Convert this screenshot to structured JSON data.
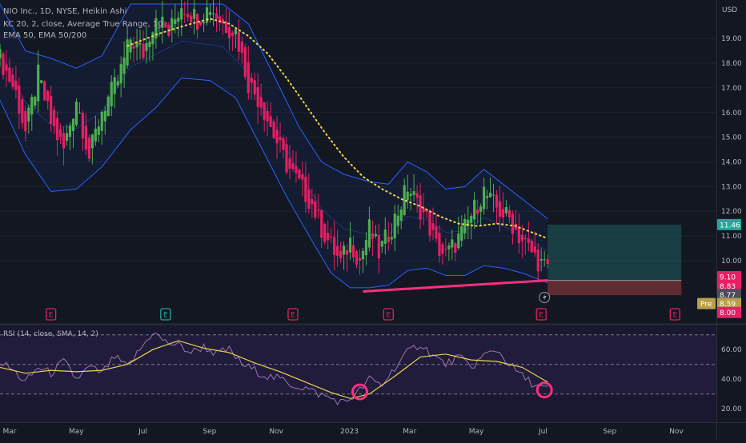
{
  "legend": {
    "line1": "NIO Inc., 1D, NYSE, Heikin Ashi",
    "line2": "KC 20, 2, close, Average True Range, 10",
    "line3": "EMA 50, EMA 50/200"
  },
  "price_axis": {
    "unit": "USD",
    "ticks": [
      "19.00",
      "18.00",
      "17.00",
      "16.00",
      "15.00",
      "14.00",
      "13.00",
      "12.00",
      "11.00",
      "10.00"
    ]
  },
  "price_badges": {
    "target": "11.46",
    "current": "9.10",
    "b2": "8.83",
    "b3": "8.77",
    "pre_label": "Pre",
    "pre_value": "8.59",
    "stop": "8.00"
  },
  "earnings_label": "E",
  "rsi": {
    "title": "RSI (14, close, SMA, 14, 2)",
    "ticks": [
      "60.00",
      "40.00",
      "20.00"
    ]
  },
  "time_axis": [
    "Mar",
    "May",
    "Jul",
    "Sep",
    "Nov",
    "2023",
    "Mar",
    "May",
    "Jul",
    "Sep",
    "Nov"
  ],
  "colors": {
    "background": "#131722",
    "candle_up": "#4caf50",
    "candle_down": "#e91e63",
    "channel": "#2962ff",
    "ema": "#e8d44d",
    "rsi_line": "#b085c8",
    "rsi_ma": "#e8d44d",
    "target_zone": "#26a69a",
    "stop_zone": "#ef5350",
    "annotation": "#ff2e7e"
  },
  "chart_data": {
    "type": "candlestick",
    "symbol": "NIO",
    "ylim": [
      7.6,
      20.4
    ],
    "x_months": [
      "Mar",
      "May",
      "Jul",
      "Sep",
      "Nov",
      "2023",
      "Mar",
      "May",
      "Jul",
      "Sep",
      "Nov"
    ],
    "price_path": [
      [
        0,
        18.2
      ],
      [
        5,
        16.8
      ],
      [
        8,
        15.2
      ],
      [
        12,
        17.5
      ],
      [
        16,
        15.6
      ],
      [
        20,
        14.5
      ],
      [
        24,
        16.6
      ],
      [
        28,
        14.2
      ],
      [
        32,
        16.1
      ],
      [
        37,
        17.3
      ],
      [
        41,
        19.0
      ],
      [
        45,
        18.4
      ],
      [
        49,
        20.0
      ],
      [
        53,
        19.2
      ],
      [
        57,
        20.4
      ],
      [
        62,
        19.8
      ],
      [
        66,
        20.3
      ],
      [
        70,
        19.6
      ],
      [
        74,
        19.3
      ],
      [
        78,
        17.2
      ],
      [
        82,
        16.4
      ],
      [
        86,
        15.1
      ],
      [
        90,
        13.9
      ],
      [
        94,
        13.1
      ],
      [
        98,
        12.3
      ],
      [
        101,
        11.3
      ],
      [
        104,
        10.6
      ],
      [
        107,
        9.9
      ],
      [
        110,
        10.8
      ],
      [
        113,
        10.0
      ],
      [
        116,
        11.3
      ],
      [
        119,
        10.3
      ],
      [
        122,
        11.1
      ],
      [
        125,
        12.0
      ],
      [
        128,
        13.0
      ],
      [
        131,
        12.3
      ],
      [
        134,
        11.7
      ],
      [
        137,
        10.6
      ],
      [
        140,
        10.2
      ],
      [
        143,
        10.7
      ],
      [
        146,
        11.3
      ],
      [
        149,
        12.1
      ],
      [
        152,
        12.8
      ],
      [
        154,
        12.4
      ],
      [
        157,
        12.0
      ],
      [
        160,
        11.7
      ],
      [
        163,
        11.0
      ],
      [
        166,
        10.5
      ],
      [
        169,
        10.0
      ],
      [
        172,
        9.6
      ]
    ],
    "keltner_upper": [
      [
        0,
        20.4
      ],
      [
        8,
        18.5
      ],
      [
        16,
        18.2
      ],
      [
        24,
        17.8
      ],
      [
        32,
        18.3
      ],
      [
        41,
        20.4
      ],
      [
        57,
        20.4
      ],
      [
        70,
        20.4
      ],
      [
        78,
        19.6
      ],
      [
        86,
        17.5
      ],
      [
        94,
        15.4
      ],
      [
        101,
        14.0
      ],
      [
        108,
        13.5
      ],
      [
        116,
        13.2
      ],
      [
        122,
        13.1
      ],
      [
        128,
        14.0
      ],
      [
        134,
        13.6
      ],
      [
        140,
        12.9
      ],
      [
        146,
        13.0
      ],
      [
        152,
        13.7
      ],
      [
        158,
        13.1
      ],
      [
        164,
        12.5
      ],
      [
        172,
        11.7
      ]
    ],
    "keltner_lower": [
      [
        0,
        16.5
      ],
      [
        8,
        14.3
      ],
      [
        16,
        12.8
      ],
      [
        24,
        12.9
      ],
      [
        32,
        13.8
      ],
      [
        41,
        15.3
      ],
      [
        49,
        16.2
      ],
      [
        57,
        17.4
      ],
      [
        66,
        17.3
      ],
      [
        74,
        16.6
      ],
      [
        82,
        14.6
      ],
      [
        90,
        12.6
      ],
      [
        98,
        10.8
      ],
      [
        104,
        9.5
      ],
      [
        110,
        8.9
      ],
      [
        116,
        8.9
      ],
      [
        122,
        9.0
      ],
      [
        128,
        9.6
      ],
      [
        134,
        9.7
      ],
      [
        140,
        9.4
      ],
      [
        146,
        9.4
      ],
      [
        152,
        9.8
      ],
      [
        158,
        9.7
      ],
      [
        164,
        9.5
      ],
      [
        172,
        9.1
      ]
    ],
    "ema": [
      [
        40,
        18.7
      ],
      [
        50,
        19.2
      ],
      [
        60,
        19.6
      ],
      [
        66,
        19.8
      ],
      [
        72,
        19.6
      ],
      [
        78,
        19.1
      ],
      [
        84,
        18.4
      ],
      [
        90,
        17.4
      ],
      [
        96,
        16.3
      ],
      [
        102,
        15.2
      ],
      [
        108,
        14.2
      ],
      [
        114,
        13.4
      ],
      [
        120,
        12.9
      ],
      [
        126,
        12.5
      ],
      [
        132,
        12.2
      ],
      [
        138,
        11.8
      ],
      [
        144,
        11.5
      ],
      [
        150,
        11.4
      ],
      [
        156,
        11.5
      ],
      [
        162,
        11.4
      ],
      [
        168,
        11.1
      ],
      [
        172,
        10.9
      ]
    ],
    "support_line": [
      [
        114,
        8.75
      ],
      [
        172,
        9.2
      ]
    ],
    "long_position": {
      "entry": 9.2,
      "target": 11.46,
      "stop": 8.6,
      "start_day": 172,
      "end_day": 214
    },
    "rsi_values": [
      [
        0,
        52
      ],
      [
        4,
        46
      ],
      [
        8,
        38
      ],
      [
        12,
        48
      ],
      [
        16,
        44
      ],
      [
        20,
        52
      ],
      [
        24,
        40
      ],
      [
        28,
        48
      ],
      [
        32,
        44
      ],
      [
        36,
        55
      ],
      [
        40,
        48
      ],
      [
        44,
        60
      ],
      [
        48,
        72
      ],
      [
        52,
        65
      ],
      [
        56,
        63
      ],
      [
        60,
        58
      ],
      [
        64,
        62
      ],
      [
        68,
        57
      ],
      [
        72,
        60
      ],
      [
        76,
        50
      ],
      [
        80,
        46
      ],
      [
        84,
        42
      ],
      [
        88,
        40
      ],
      [
        92,
        36
      ],
      [
        96,
        34
      ],
      [
        100,
        30
      ],
      [
        104,
        27
      ],
      [
        108,
        24
      ],
      [
        112,
        30
      ],
      [
        116,
        40
      ],
      [
        120,
        36
      ],
      [
        124,
        48
      ],
      [
        128,
        58
      ],
      [
        132,
        64
      ],
      [
        136,
        56
      ],
      [
        140,
        50
      ],
      [
        144,
        55
      ],
      [
        148,
        48
      ],
      [
        152,
        56
      ],
      [
        156,
        60
      ],
      [
        160,
        50
      ],
      [
        164,
        42
      ],
      [
        168,
        36
      ],
      [
        172,
        33
      ]
    ],
    "rsi_ma": [
      [
        0,
        48
      ],
      [
        8,
        44
      ],
      [
        16,
        46
      ],
      [
        24,
        45
      ],
      [
        32,
        46
      ],
      [
        40,
        50
      ],
      [
        48,
        60
      ],
      [
        56,
        66
      ],
      [
        64,
        61
      ],
      [
        72,
        58
      ],
      [
        80,
        51
      ],
      [
        88,
        45
      ],
      [
        96,
        38
      ],
      [
        104,
        31
      ],
      [
        110,
        27
      ],
      [
        116,
        30
      ],
      [
        124,
        42
      ],
      [
        132,
        55
      ],
      [
        140,
        57
      ],
      [
        148,
        53
      ],
      [
        156,
        52
      ],
      [
        164,
        48
      ],
      [
        172,
        38
      ]
    ],
    "rsi_ylim": [
      12,
      72
    ],
    "rsi_levels": [
      70,
      50,
      30
    ],
    "earnings_days": [
      16,
      52,
      92,
      122,
      170,
      212
    ],
    "marked_lows_days": [
      113,
      171
    ]
  }
}
